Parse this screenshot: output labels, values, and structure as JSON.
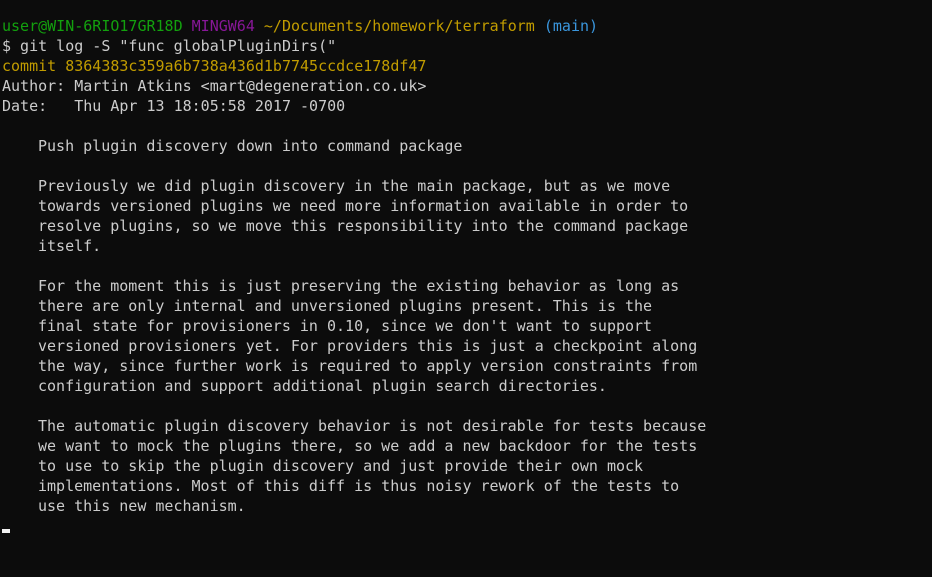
{
  "prompt": {
    "user_host": "user@WIN-6RIO17GR18D",
    "env": "MINGW64",
    "path": "~/Documents/homework/terraform",
    "branch": "(main)"
  },
  "command": "$ git log -S \"func globalPluginDirs(\"",
  "commit": {
    "line": "commit 8364383c359a6b738a436d1b7745ccdce178df47",
    "author_line": "Author: Martin Atkins <mart@degeneration.co.uk>",
    "date_line": "Date:   Thu Apr 13 18:05:58 2017 -0700",
    "subject": "Push plugin discovery down into command package",
    "body": [
      [
        "Previously we did plugin discovery in the main package, but as we move",
        "towards versioned plugins we need more information available in order to",
        "resolve plugins, so we move this responsibility into the command package",
        "itself."
      ],
      [
        "For the moment this is just preserving the existing behavior as long as",
        "there are only internal and unversioned plugins present. This is the",
        "final state for provisioners in 0.10, since we don't want to support",
        "versioned provisioners yet. For providers this is just a checkpoint along",
        "the way, since further work is required to apply version constraints from",
        "configuration and support additional plugin search directories."
      ],
      [
        "The automatic plugin discovery behavior is not desirable for tests because",
        "we want to mock the plugins there, so we add a new backdoor for the tests",
        "to use to skip the plugin discovery and just provide their own mock",
        "implementations. Most of this diff is thus noisy rework of the tests to",
        "use this new mechanism."
      ]
    ]
  },
  "colors": {
    "background": "#0c0c0c",
    "text": "#cccccc",
    "user_host": "#13a10e",
    "env": "#881798",
    "path": "#c19c00",
    "branch": "#3a96dd",
    "commit": "#c19c00"
  }
}
